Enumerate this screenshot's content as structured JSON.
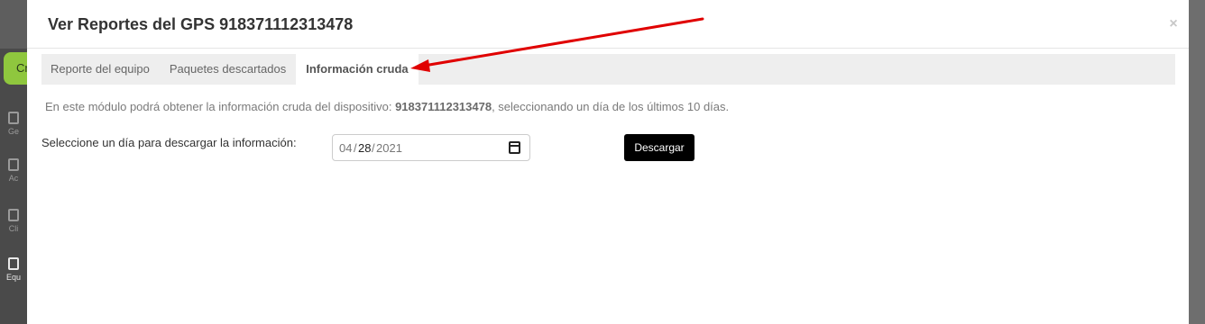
{
  "background": {
    "create_button_label": "Cr",
    "nav_items": [
      {
        "label": "Ge"
      },
      {
        "label": "Ac"
      },
      {
        "label": "Cli"
      },
      {
        "label": "Equ"
      }
    ]
  },
  "modal": {
    "title": "Ver Reportes del GPS 918371112313478",
    "close_label": "×",
    "tabs": [
      {
        "label": "Reporte del equipo",
        "active": false
      },
      {
        "label": "Paquetes descartados",
        "active": false
      },
      {
        "label": "Información cruda",
        "active": true
      }
    ],
    "info": {
      "prefix": "En este módulo podrá obtener la información cruda del dispositivo: ",
      "device_id": "918371112313478",
      "suffix": ", seleccionando un día de los últimos 10 días."
    },
    "form": {
      "label": "Seleccione un día para descargar la información:",
      "date_month": "04",
      "date_day": "28",
      "date_year": "2021",
      "date_separator": "/",
      "download_label": "Descargar"
    }
  },
  "colors": {
    "annotation_arrow": "#e00000",
    "download_button": "#000000",
    "tabs_background": "#eeeeee",
    "create_button": "#8fc73e"
  }
}
